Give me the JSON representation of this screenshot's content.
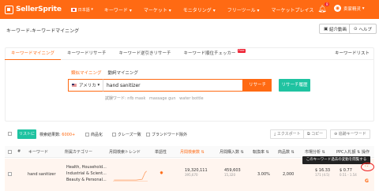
{
  "header": {
    "brand": "SellerSprite",
    "lang": "日本語",
    "nav": [
      "キーワード",
      "マーケット",
      "モニタリング",
      "フリーツール",
      "マーケットプレイス"
    ],
    "notif_count": "8",
    "user": "卖家精灵"
  },
  "breadcrumb": "キーワード-キーワードマイニング",
  "actions": {
    "guide": "紹介動画",
    "help": "ヘルプ"
  },
  "tabs": [
    "キーワードマイニング",
    "キーワードリサーチ",
    "キーワード逆引きリサーチ",
    "キーワード順位チェッカー"
  ],
  "tab_badge": "Free",
  "tab_right": "キーワードリスト",
  "subtabs": [
    "類似マイニング",
    "動詞マイニング"
  ],
  "search": {
    "market": "アメリカ",
    "value": "hand sanitizer",
    "button": "リサーチ",
    "history": "リサーチ履歴",
    "suggest_label": "試験ワード:",
    "suggestions": [
      "nfb mask",
      "massage gun",
      "water bottle"
    ]
  },
  "filters": {
    "list_button": "リストに追加",
    "result_label": "検索結果数:",
    "result_count": "6000+",
    "options": [
      "商品化",
      "クレーズ一致",
      "ブランドワード除外"
    ],
    "export": "エクスポート",
    "copy": "コピー",
    "track": "追跡キーワード"
  },
  "table": {
    "headers": [
      "#",
      "キーワード",
      "所属カテゴリー",
      "月間検索トレンド",
      "単語性",
      "月間検索数",
      "月間購入数",
      "転換率",
      "商品数",
      "市場分析",
      "PPC入札額",
      "操作"
    ],
    "tooltip": "このキーワード過去の変動を閲覧する",
    "rows": [
      {
        "keyword": "hand sanitizer",
        "categories": [
          "Health, Household...",
          "Industrial & Scient...",
          "Beauty & Personal..."
        ],
        "searches": "19,320,111",
        "searches_sub": "395,670",
        "purchases": "459,603",
        "purchases_sub": "15,320",
        "conversion": "3.00%",
        "products": "2,000",
        "market_price": "$ 16.33",
        "market_sub": "171 (4.5)",
        "ppc": "$ 0.77",
        "ppc_sub": "0.51 - 1.54"
      }
    ]
  }
}
